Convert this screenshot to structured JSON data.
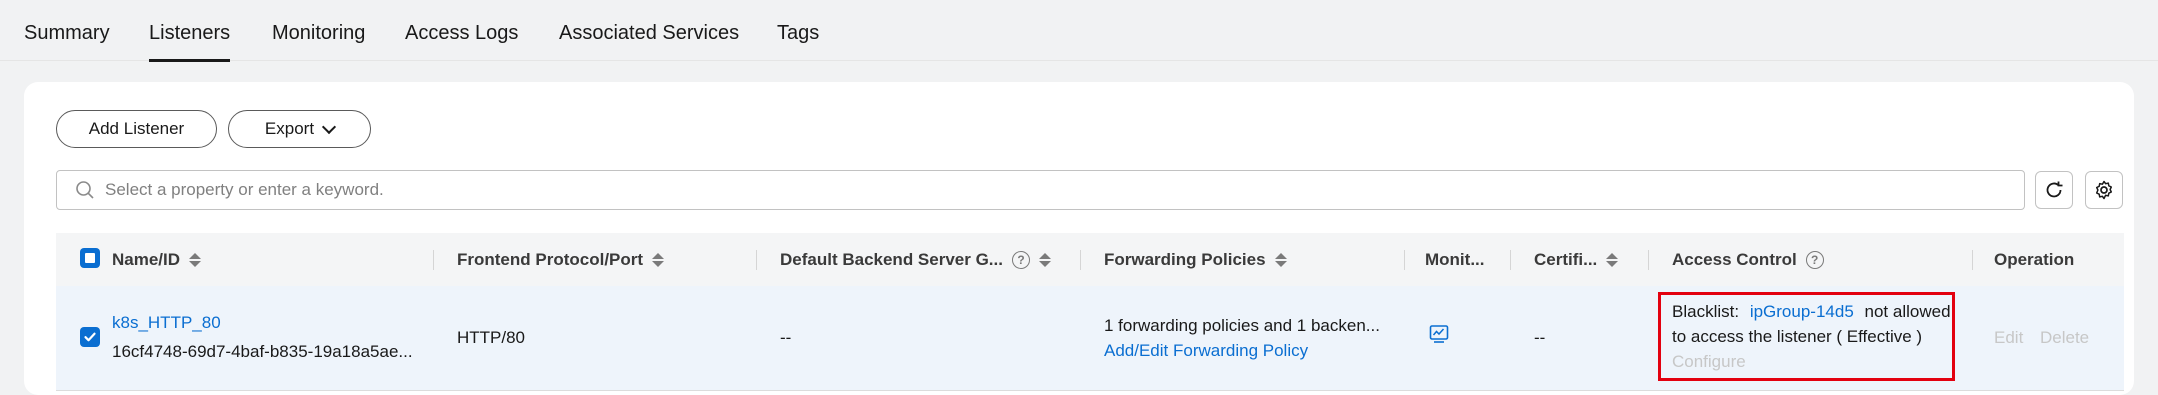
{
  "tabs": [
    {
      "label": "Summary",
      "active": false
    },
    {
      "label": "Listeners",
      "active": true
    },
    {
      "label": "Monitoring",
      "active": false
    },
    {
      "label": "Access Logs",
      "active": false
    },
    {
      "label": "Associated Services",
      "active": false
    },
    {
      "label": "Tags",
      "active": false
    }
  ],
  "toolbar": {
    "add_listener_label": "Add Listener",
    "export_label": "Export"
  },
  "search": {
    "placeholder": "Select a property or enter a keyword."
  },
  "table": {
    "columns": {
      "name_id": "Name/ID",
      "frontend": "Frontend Protocol/Port",
      "backend_group": "Default Backend Server G...",
      "forwarding": "Forwarding Policies",
      "monitoring": "Monit...",
      "certificate": "Certifi...",
      "access_control": "Access Control",
      "operation": "Operation"
    },
    "rows": [
      {
        "name": "k8s_HTTP_80",
        "id": "16cf4748-69d7-4baf-b835-19a18a5ae...",
        "frontend": "HTTP/80",
        "backend_group": "--",
        "forwarding_summary": "1 forwarding policies and 1 backen...",
        "forwarding_link": "Add/Edit Forwarding Policy",
        "certificate": "--",
        "access_control": {
          "prefix": "Blacklist:",
          "group": "ipGroup-14d5",
          "suffix": "not allowed",
          "line2": "to access the listener ( Effective )",
          "configure": "Configure"
        },
        "operations": {
          "edit": "Edit",
          "delete": "Delete"
        }
      }
    ]
  },
  "colors": {
    "accent": "#0a6ed1",
    "highlight_border": "#e3000f",
    "disabled_text": "#c7c7c7"
  }
}
